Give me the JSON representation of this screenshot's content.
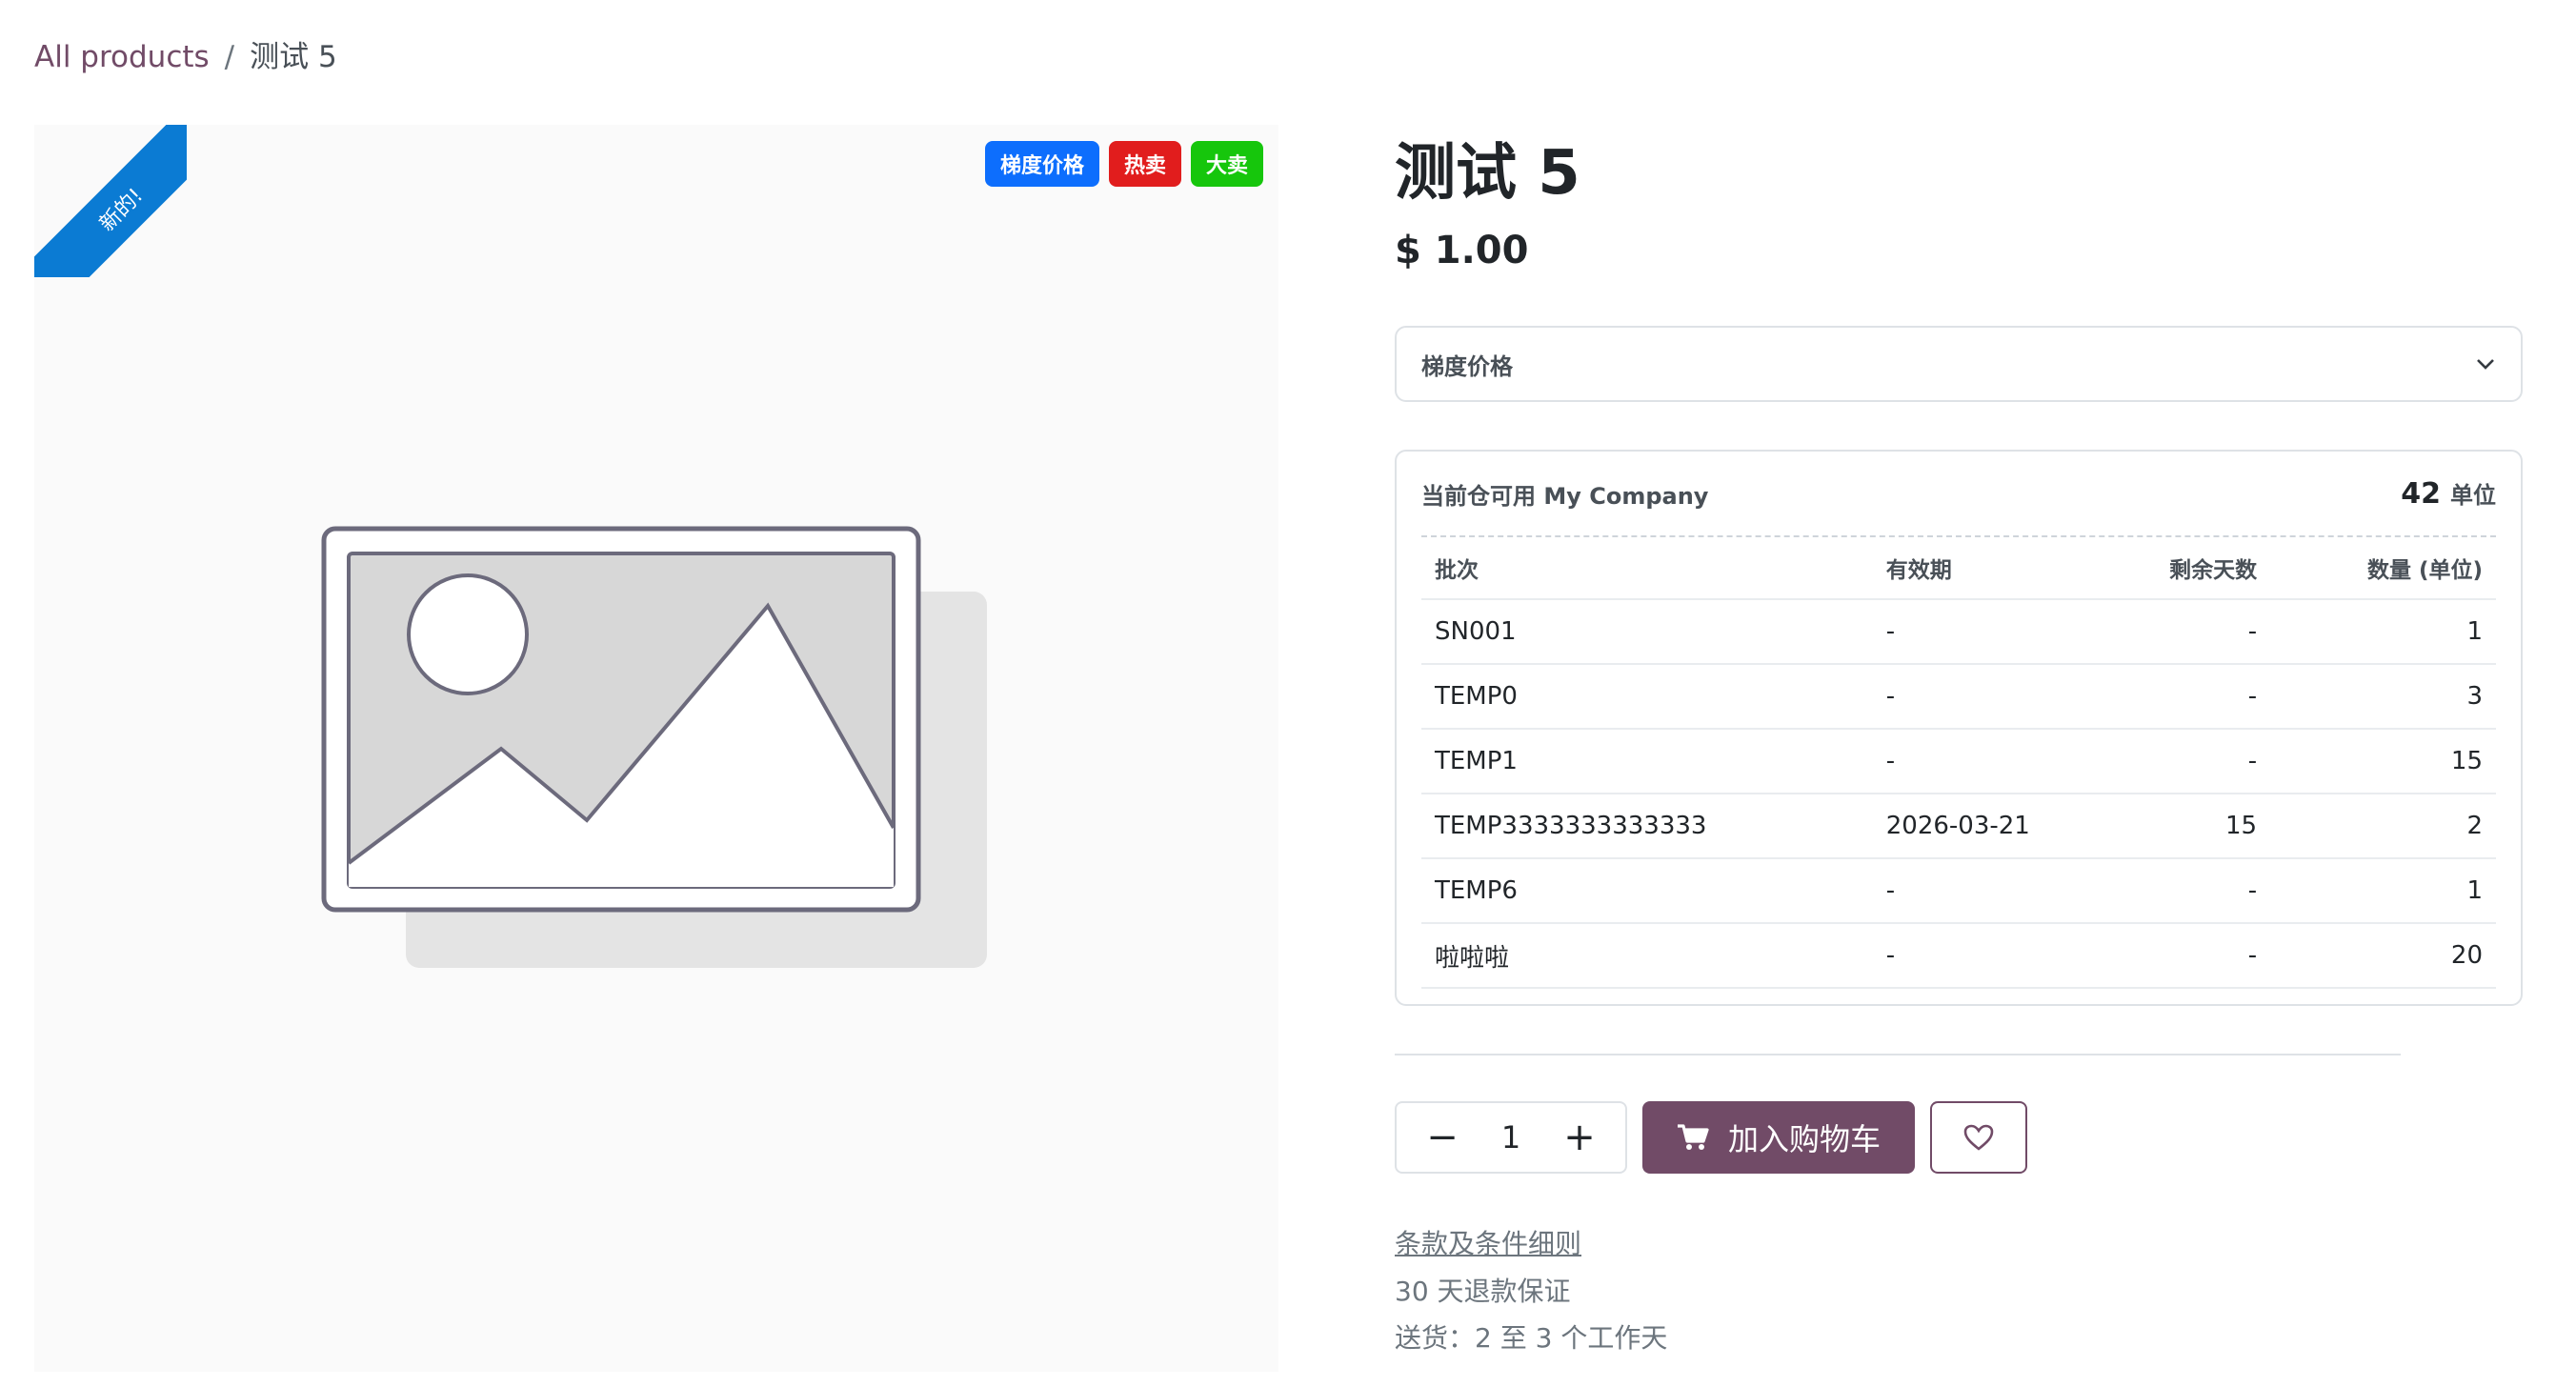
{
  "breadcrumb": {
    "root": "All products",
    "separator": "/",
    "current": "测试 5"
  },
  "ribbon": {
    "label": "新的!",
    "color": "#0b7bd3"
  },
  "badges": [
    {
      "label": "梯度价格",
      "color": "#0d6efd"
    },
    {
      "label": "热卖",
      "color": "#e11d1d"
    },
    {
      "label": "大卖",
      "color": "#16c60c"
    }
  ],
  "product": {
    "title": "测试 5",
    "price": "$ 1.00"
  },
  "tier_price": {
    "label": "梯度价格",
    "icon": "chevron-down-icon"
  },
  "stock": {
    "location_label": "当前仓可用 My Company",
    "total_qty": "42",
    "unit": "单位",
    "columns": [
      "批次",
      "有效期",
      "剩余天数",
      "数量 (单位)"
    ],
    "rows": [
      [
        "SN001",
        "-",
        "-",
        "1"
      ],
      [
        "TEMP0",
        "-",
        "-",
        "3"
      ],
      [
        "TEMP1",
        "-",
        "-",
        "15"
      ],
      [
        "TEMP3333333333333",
        "2026-03-21",
        "15",
        "2"
      ],
      [
        "TEMP6",
        "-",
        "-",
        "1"
      ],
      [
        "啦啦啦",
        "-",
        "-",
        "20"
      ]
    ]
  },
  "quantity": {
    "minus": "−",
    "value": "1",
    "plus": "+"
  },
  "actions": {
    "add_to_cart": "加入购物车",
    "accent": "#714b67"
  },
  "info": {
    "terms": "条款及条件细则",
    "guarantee": "30 天退款保证",
    "shipping": "送货：2 至 3 个工作天"
  }
}
